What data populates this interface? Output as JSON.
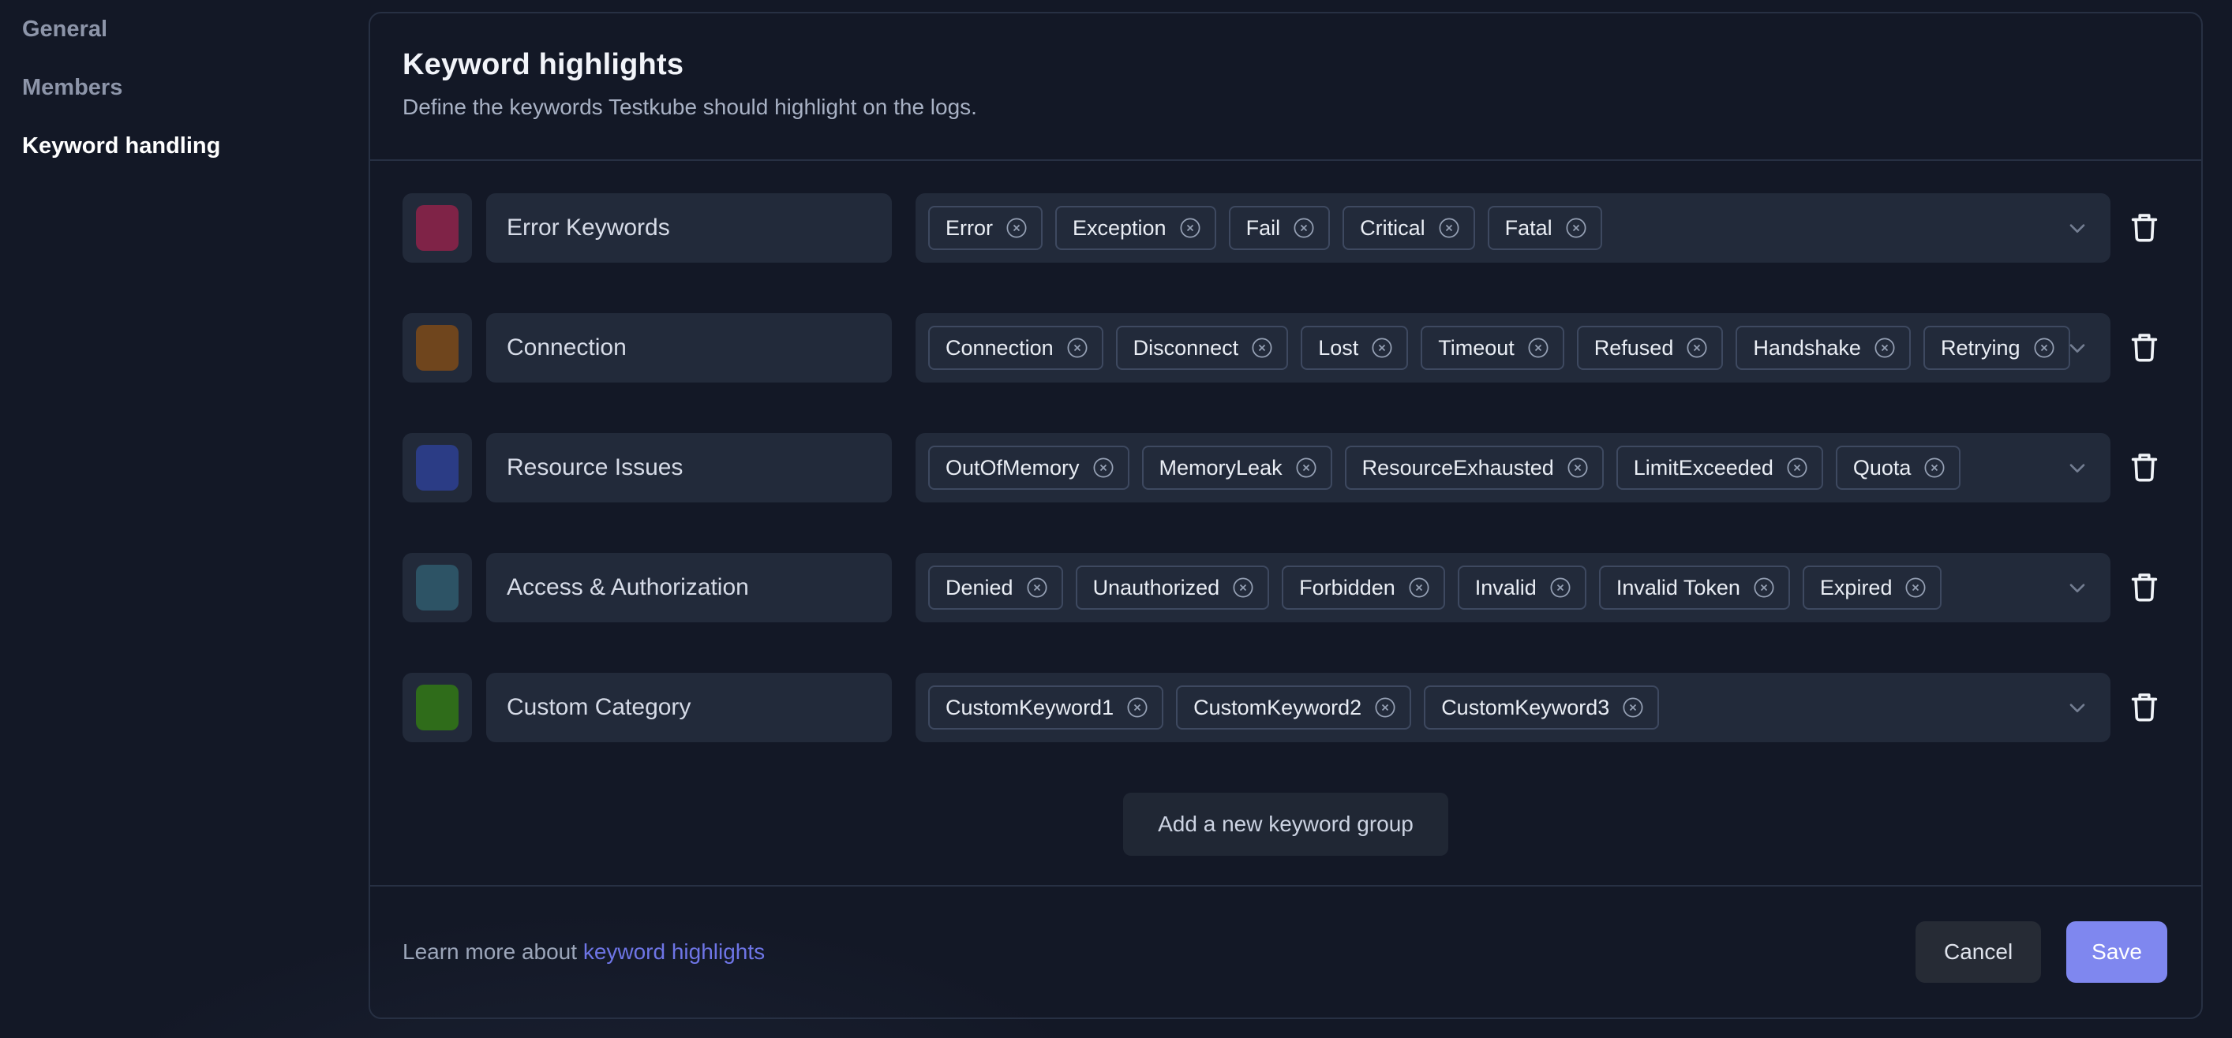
{
  "sidebar": {
    "items": [
      {
        "label": "General",
        "active": false
      },
      {
        "label": "Members",
        "active": false
      },
      {
        "label": "Keyword handling",
        "active": true
      }
    ]
  },
  "header": {
    "title": "Keyword highlights",
    "subtitle": "Define the keywords Testkube should highlight on the logs."
  },
  "groups": [
    {
      "name": "Error Keywords",
      "color": "#7f2347",
      "keywords": [
        "Error",
        "Exception",
        "Fail",
        "Critical",
        "Fatal"
      ]
    },
    {
      "name": "Connection",
      "color": "#6f451d",
      "keywords": [
        "Connection",
        "Disconnect",
        "Lost",
        "Timeout",
        "Refused",
        "Handshake",
        "Retrying"
      ]
    },
    {
      "name": "Resource Issues",
      "color": "#2b3c85",
      "keywords": [
        "OutOfMemory",
        "MemoryLeak",
        "ResourceExhausted",
        "LimitExceeded",
        "Quota"
      ]
    },
    {
      "name": "Access & Authorization",
      "color": "#2d5365",
      "keywords": [
        "Denied",
        "Unauthorized",
        "Forbidden",
        "Invalid",
        "Invalid Token",
        "Expired"
      ]
    },
    {
      "name": "Custom Category",
      "color": "#2f6c1a",
      "keywords": [
        "CustomKeyword1",
        "CustomKeyword2",
        "CustomKeyword3"
      ]
    }
  ],
  "actions": {
    "add_group": "Add a new keyword group",
    "cancel": "Cancel",
    "save": "Save"
  },
  "footer": {
    "learn_more_prefix": "Learn more about ",
    "learn_more_link": "keyword highlights"
  },
  "icons": {
    "remove_keyword": "circle-x",
    "expand": "chevron-down",
    "delete_group": "trash"
  },
  "colors": {
    "page_bg": "#131826",
    "surface": "#222a3a",
    "panel_border": "#273043",
    "chip_border": "#3e4960",
    "accent_save": "#7f87ef",
    "link": "#6e75e6"
  }
}
